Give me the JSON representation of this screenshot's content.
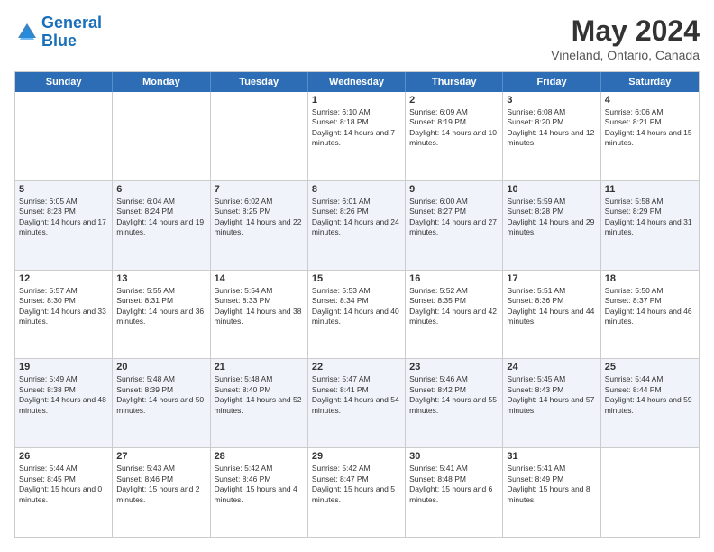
{
  "header": {
    "logo_line1": "General",
    "logo_line2": "Blue",
    "title": "May 2024",
    "subtitle": "Vineland, Ontario, Canada"
  },
  "days_of_week": [
    "Sunday",
    "Monday",
    "Tuesday",
    "Wednesday",
    "Thursday",
    "Friday",
    "Saturday"
  ],
  "weeks": [
    {
      "alt": false,
      "cells": [
        {
          "empty": true
        },
        {
          "empty": true
        },
        {
          "empty": true
        },
        {
          "num": "1",
          "sunrise": "Sunrise: 6:10 AM",
          "sunset": "Sunset: 8:18 PM",
          "daylight": "Daylight: 14 hours and 7 minutes."
        },
        {
          "num": "2",
          "sunrise": "Sunrise: 6:09 AM",
          "sunset": "Sunset: 8:19 PM",
          "daylight": "Daylight: 14 hours and 10 minutes."
        },
        {
          "num": "3",
          "sunrise": "Sunrise: 6:08 AM",
          "sunset": "Sunset: 8:20 PM",
          "daylight": "Daylight: 14 hours and 12 minutes."
        },
        {
          "num": "4",
          "sunrise": "Sunrise: 6:06 AM",
          "sunset": "Sunset: 8:21 PM",
          "daylight": "Daylight: 14 hours and 15 minutes."
        }
      ]
    },
    {
      "alt": true,
      "cells": [
        {
          "num": "5",
          "sunrise": "Sunrise: 6:05 AM",
          "sunset": "Sunset: 8:23 PM",
          "daylight": "Daylight: 14 hours and 17 minutes."
        },
        {
          "num": "6",
          "sunrise": "Sunrise: 6:04 AM",
          "sunset": "Sunset: 8:24 PM",
          "daylight": "Daylight: 14 hours and 19 minutes."
        },
        {
          "num": "7",
          "sunrise": "Sunrise: 6:02 AM",
          "sunset": "Sunset: 8:25 PM",
          "daylight": "Daylight: 14 hours and 22 minutes."
        },
        {
          "num": "8",
          "sunrise": "Sunrise: 6:01 AM",
          "sunset": "Sunset: 8:26 PM",
          "daylight": "Daylight: 14 hours and 24 minutes."
        },
        {
          "num": "9",
          "sunrise": "Sunrise: 6:00 AM",
          "sunset": "Sunset: 8:27 PM",
          "daylight": "Daylight: 14 hours and 27 minutes."
        },
        {
          "num": "10",
          "sunrise": "Sunrise: 5:59 AM",
          "sunset": "Sunset: 8:28 PM",
          "daylight": "Daylight: 14 hours and 29 minutes."
        },
        {
          "num": "11",
          "sunrise": "Sunrise: 5:58 AM",
          "sunset": "Sunset: 8:29 PM",
          "daylight": "Daylight: 14 hours and 31 minutes."
        }
      ]
    },
    {
      "alt": false,
      "cells": [
        {
          "num": "12",
          "sunrise": "Sunrise: 5:57 AM",
          "sunset": "Sunset: 8:30 PM",
          "daylight": "Daylight: 14 hours and 33 minutes."
        },
        {
          "num": "13",
          "sunrise": "Sunrise: 5:55 AM",
          "sunset": "Sunset: 8:31 PM",
          "daylight": "Daylight: 14 hours and 36 minutes."
        },
        {
          "num": "14",
          "sunrise": "Sunrise: 5:54 AM",
          "sunset": "Sunset: 8:33 PM",
          "daylight": "Daylight: 14 hours and 38 minutes."
        },
        {
          "num": "15",
          "sunrise": "Sunrise: 5:53 AM",
          "sunset": "Sunset: 8:34 PM",
          "daylight": "Daylight: 14 hours and 40 minutes."
        },
        {
          "num": "16",
          "sunrise": "Sunrise: 5:52 AM",
          "sunset": "Sunset: 8:35 PM",
          "daylight": "Daylight: 14 hours and 42 minutes."
        },
        {
          "num": "17",
          "sunrise": "Sunrise: 5:51 AM",
          "sunset": "Sunset: 8:36 PM",
          "daylight": "Daylight: 14 hours and 44 minutes."
        },
        {
          "num": "18",
          "sunrise": "Sunrise: 5:50 AM",
          "sunset": "Sunset: 8:37 PM",
          "daylight": "Daylight: 14 hours and 46 minutes."
        }
      ]
    },
    {
      "alt": true,
      "cells": [
        {
          "num": "19",
          "sunrise": "Sunrise: 5:49 AM",
          "sunset": "Sunset: 8:38 PM",
          "daylight": "Daylight: 14 hours and 48 minutes."
        },
        {
          "num": "20",
          "sunrise": "Sunrise: 5:48 AM",
          "sunset": "Sunset: 8:39 PM",
          "daylight": "Daylight: 14 hours and 50 minutes."
        },
        {
          "num": "21",
          "sunrise": "Sunrise: 5:48 AM",
          "sunset": "Sunset: 8:40 PM",
          "daylight": "Daylight: 14 hours and 52 minutes."
        },
        {
          "num": "22",
          "sunrise": "Sunrise: 5:47 AM",
          "sunset": "Sunset: 8:41 PM",
          "daylight": "Daylight: 14 hours and 54 minutes."
        },
        {
          "num": "23",
          "sunrise": "Sunrise: 5:46 AM",
          "sunset": "Sunset: 8:42 PM",
          "daylight": "Daylight: 14 hours and 55 minutes."
        },
        {
          "num": "24",
          "sunrise": "Sunrise: 5:45 AM",
          "sunset": "Sunset: 8:43 PM",
          "daylight": "Daylight: 14 hours and 57 minutes."
        },
        {
          "num": "25",
          "sunrise": "Sunrise: 5:44 AM",
          "sunset": "Sunset: 8:44 PM",
          "daylight": "Daylight: 14 hours and 59 minutes."
        }
      ]
    },
    {
      "alt": false,
      "cells": [
        {
          "num": "26",
          "sunrise": "Sunrise: 5:44 AM",
          "sunset": "Sunset: 8:45 PM",
          "daylight": "Daylight: 15 hours and 0 minutes."
        },
        {
          "num": "27",
          "sunrise": "Sunrise: 5:43 AM",
          "sunset": "Sunset: 8:46 PM",
          "daylight": "Daylight: 15 hours and 2 minutes."
        },
        {
          "num": "28",
          "sunrise": "Sunrise: 5:42 AM",
          "sunset": "Sunset: 8:46 PM",
          "daylight": "Daylight: 15 hours and 4 minutes."
        },
        {
          "num": "29",
          "sunrise": "Sunrise: 5:42 AM",
          "sunset": "Sunset: 8:47 PM",
          "daylight": "Daylight: 15 hours and 5 minutes."
        },
        {
          "num": "30",
          "sunrise": "Sunrise: 5:41 AM",
          "sunset": "Sunset: 8:48 PM",
          "daylight": "Daylight: 15 hours and 6 minutes."
        },
        {
          "num": "31",
          "sunrise": "Sunrise: 5:41 AM",
          "sunset": "Sunset: 8:49 PM",
          "daylight": "Daylight: 15 hours and 8 minutes."
        },
        {
          "empty": true
        }
      ]
    }
  ]
}
